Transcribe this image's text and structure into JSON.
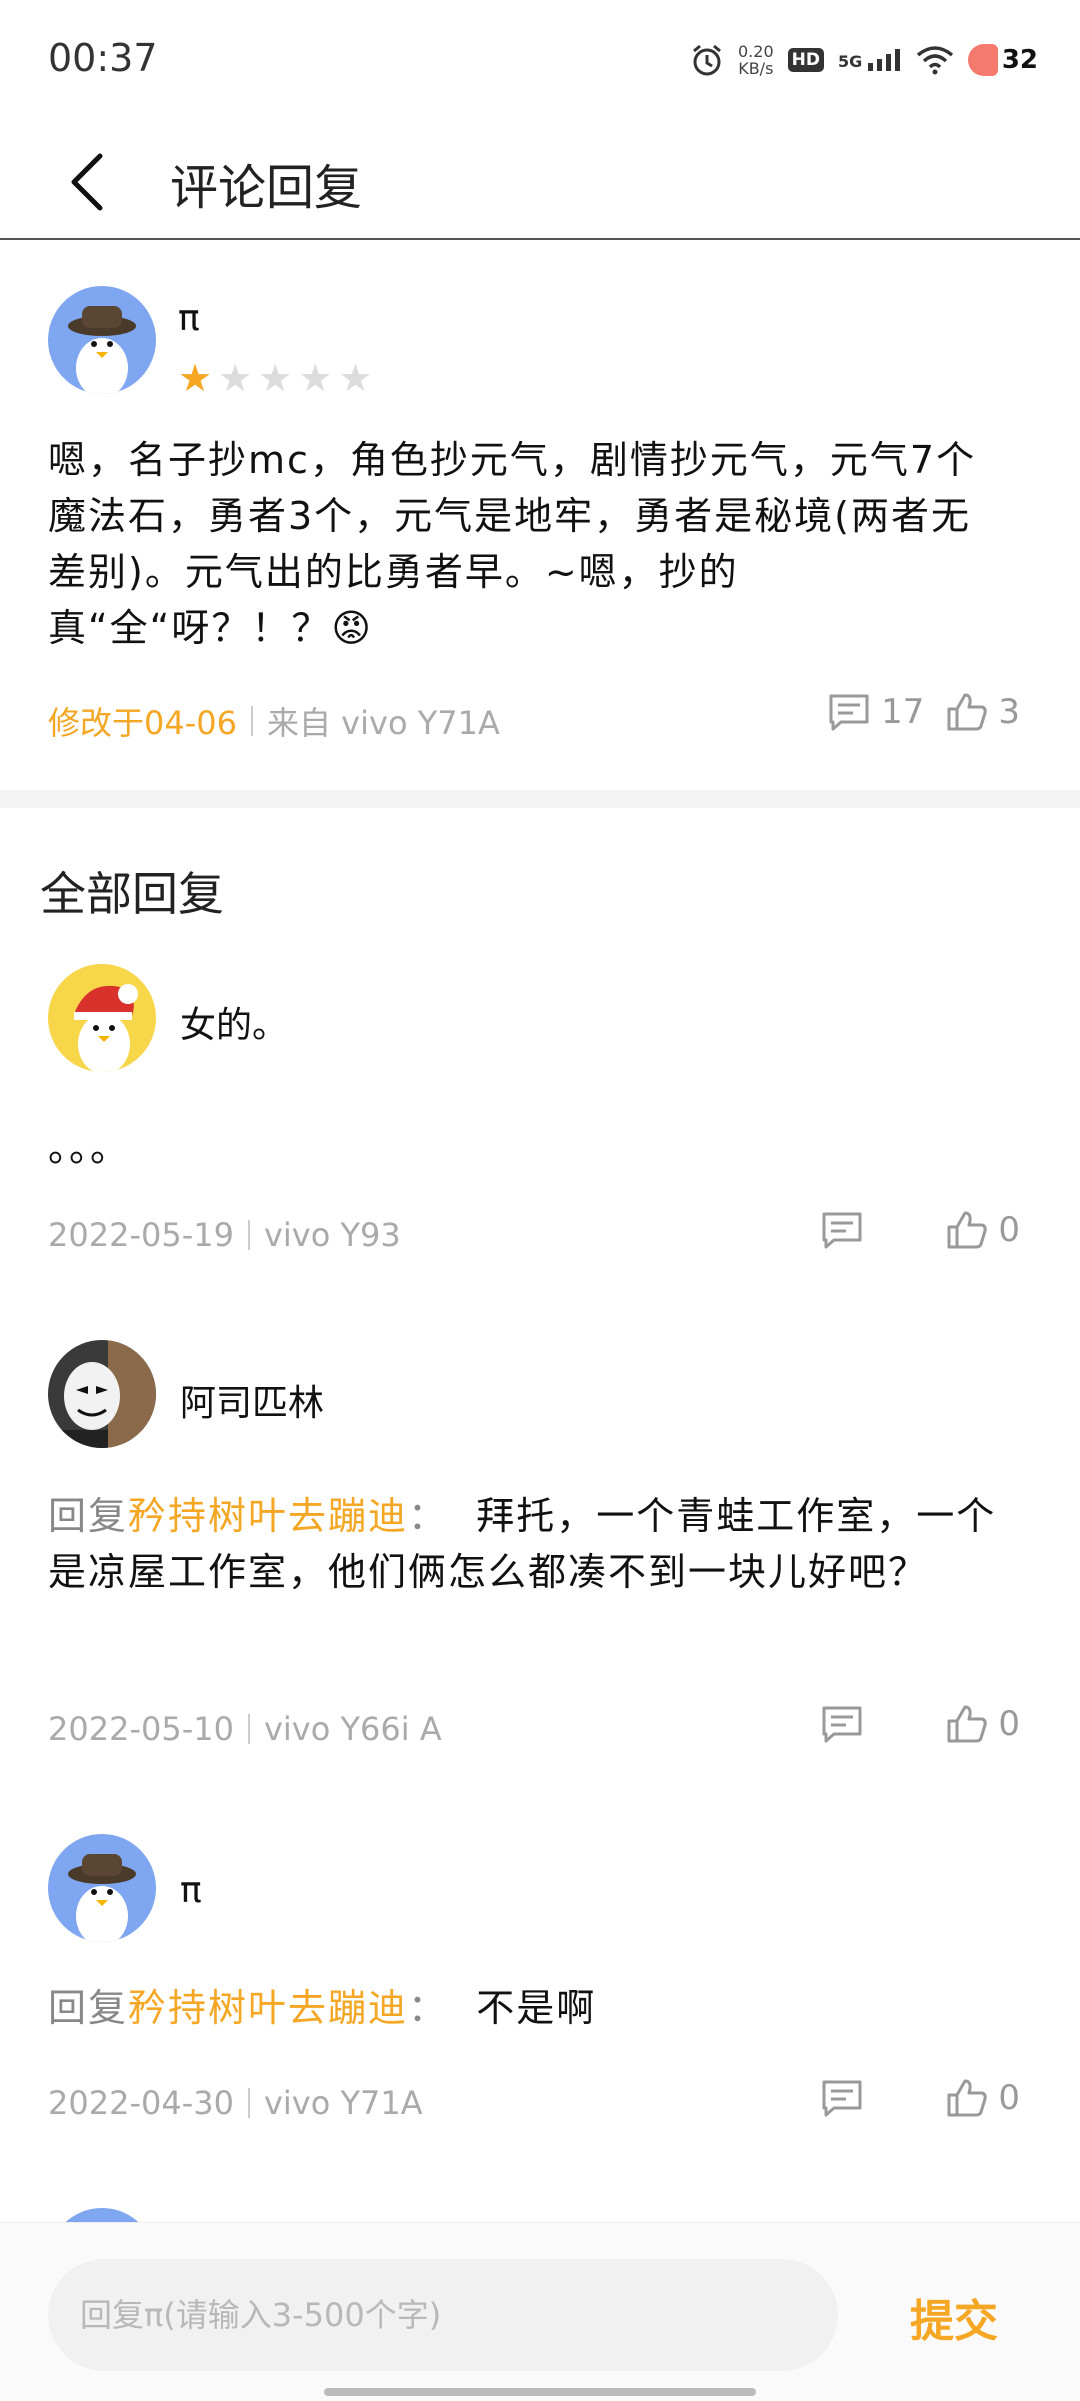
{
  "status": {
    "time": "00:37",
    "speed_value": "0.20",
    "speed_unit": "KB/s",
    "hd": "HD",
    "network": "5G",
    "battery": "32"
  },
  "header": {
    "title": "评论回复"
  },
  "comment": {
    "user": "π",
    "rating": 1,
    "rating_max": 5,
    "text": "嗯，名子抄mc，角色抄元气，剧情抄元气，元气7个魔法石，勇者3个，元气是地牢，勇者是秘境(两者无差别)。元气出的比勇者早。~嗯，抄的真“全“呀？！？😡",
    "modified": "修改于04-06",
    "source": "来自  vivo  Y71A",
    "reply_count": "17",
    "like_count": "3"
  },
  "section": {
    "title": "全部回复"
  },
  "replies": [
    {
      "user": "女的。",
      "text": "。。。",
      "date": "2022-05-19",
      "device": "vivo  Y93",
      "likes": "0"
    },
    {
      "user": "阿司匹林",
      "reply_prefix": "回复",
      "reply_to": "矜持树叶去蹦迪",
      "colon": "：",
      "text": "拜托，一个青蛙工作室，一个是凉屋工作室，他们俩怎么都凑不到一块儿好吧？",
      "date": "2022-05-10",
      "device": "vivo  Y66i  A",
      "likes": "0"
    },
    {
      "user": "π",
      "reply_prefix": "回复",
      "reply_to": "矜持树叶去蹦迪",
      "colon": "：",
      "text": "不是啊",
      "date": "2022-04-30",
      "device": "vivo  Y71A",
      "likes": "0"
    }
  ],
  "input": {
    "placeholder": "回复π(请输入3-500个字)"
  },
  "submit": {
    "label": "提交"
  },
  "colors": {
    "accent": "#f5a623",
    "meta_gray": "#aaaaaa"
  }
}
